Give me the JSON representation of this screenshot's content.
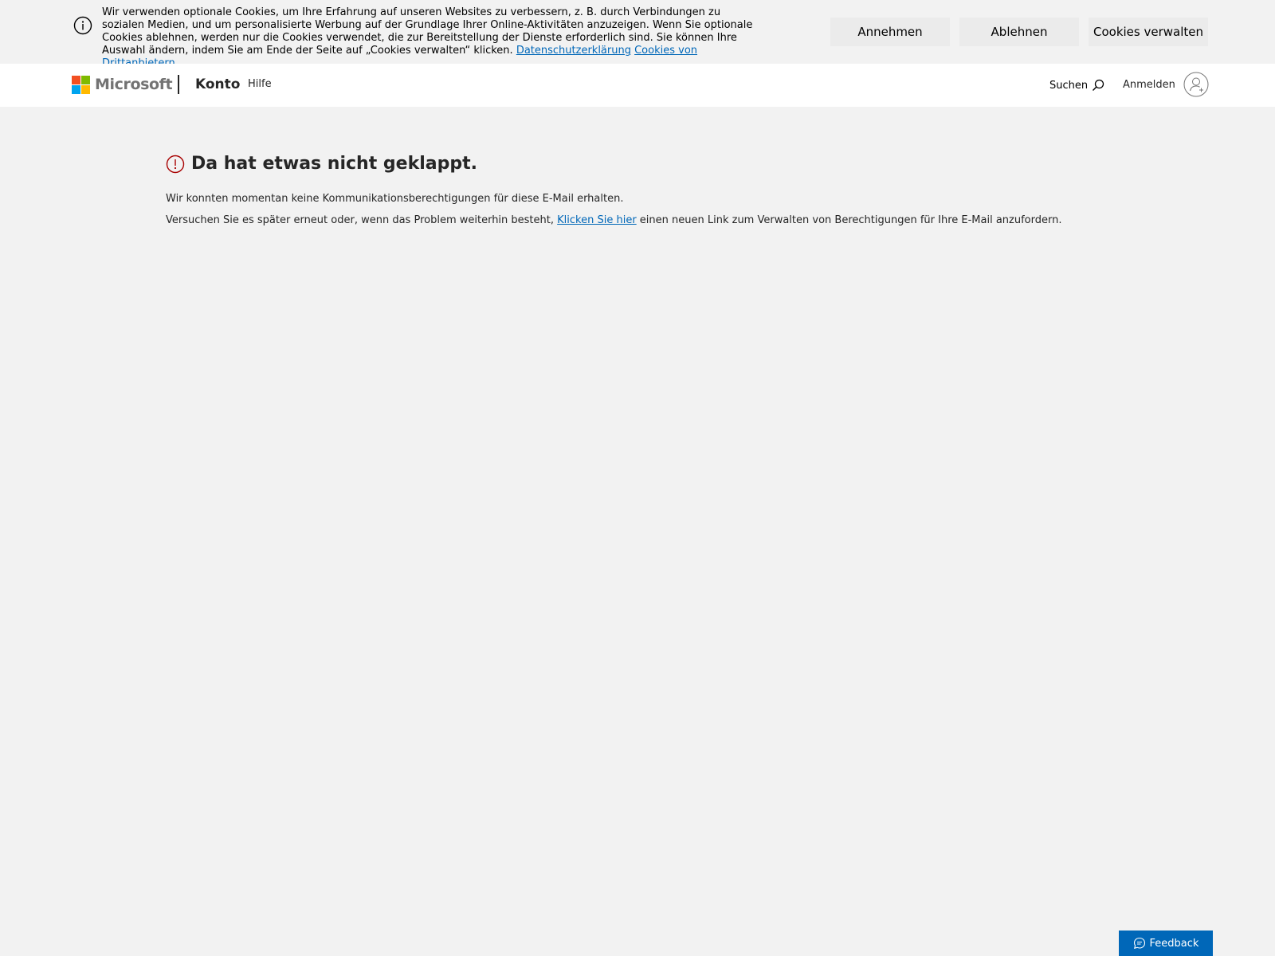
{
  "cookie_banner": {
    "text": "Wir verwenden optionale Cookies, um Ihre Erfahrung auf unseren Websites zu verbessern, z. B. durch Verbindungen zu sozialen Medien, und um personalisierte Werbung auf der Grundlage Ihrer Online-Aktivitäten anzuzeigen. Wenn Sie optionale Cookies ablehnen, werden nur die Cookies verwendet, die zur Bereitstellung der Dienste erforderlich sind. Sie können Ihre Auswahl ändern, indem Sie am Ende der Seite auf „Cookies verwalten“ klicken.",
    "privacy_link": "Datenschutzerklärung",
    "third_party_link": "Cookies von Drittanbietern",
    "accept_label": "Annehmen",
    "reject_label": "Ablehnen",
    "manage_label": "Cookies verwalten"
  },
  "header": {
    "logo_text": "Microsoft",
    "brand": "Konto",
    "nav_help": "Hilfe",
    "search_label": "Suchen",
    "signin_label": "Anmelden"
  },
  "main": {
    "error_title": "Da hat etwas nicht geklappt.",
    "message_1": "Wir konnten momentan keine Kommunikationsberechtigungen für diese E-Mail erhalten.",
    "message_2_before": "Versuchen Sie es später erneut oder, wenn das Problem weiterhin besteht, ",
    "message_2_link": "Klicken Sie hier",
    "message_2_after": " einen neuen Link zum Verwalten von Berechtigungen für Ihre E-Mail anzufordern."
  },
  "feedback": {
    "label": "Feedback"
  },
  "colors": {
    "accent": "#0067b8",
    "error": "#a80000",
    "background": "#f2f2f2"
  }
}
